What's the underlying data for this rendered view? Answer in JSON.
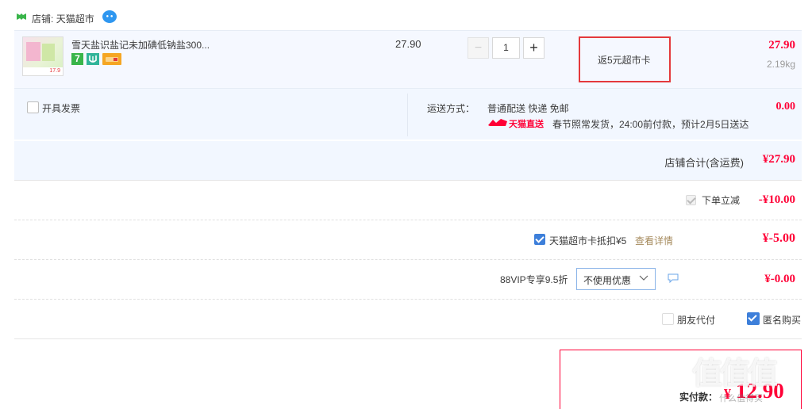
{
  "shop": {
    "label": "店铺:",
    "name": "天猫超市",
    "wangwang_badge": "● ●"
  },
  "item": {
    "title": "雪天盐识盐记未加碘低钠盐300...",
    "unit_price": "27.90",
    "quantity": "1",
    "minus": "−",
    "plus": "+",
    "promo_tag": "返5元超市卡",
    "subtotal": "27.90",
    "weight": "2.19kg",
    "thumb_price": "17.9",
    "badge_seven": "7"
  },
  "invoice": {
    "label": "开具发票"
  },
  "shipping": {
    "label": "运送方式：",
    "method": "普通配送 快递 免邮",
    "fee": "0.00",
    "brand": "天猫直送",
    "notice": "春节照常发货，24:00前付款，预计2月5日送达"
  },
  "shop_total": {
    "label": "店铺合计(含运费)",
    "value": "¥27.90"
  },
  "discounts": [
    {
      "label": "下单立减",
      "value": "-¥10.00"
    },
    {
      "label": "天猫超市卡抵扣¥5",
      "link": "查看详情",
      "value": "¥-5.00"
    },
    {
      "label": "88VIP专享9.5折",
      "select": "不使用优惠",
      "value": "¥-0.00"
    }
  ],
  "options": {
    "friend_pay": "朋友代付",
    "anonymous": "匿名购买"
  },
  "summary": {
    "total_label": "实付款：",
    "total_value": "12.90",
    "currency": "¥"
  },
  "watermark": {
    "logo_text": "值值值",
    "sub": "什么值得买"
  },
  "colors": {
    "accent_red": "#ff0036",
    "blue_check": "#3d7fda",
    "highlight_box": "#e4393c"
  }
}
